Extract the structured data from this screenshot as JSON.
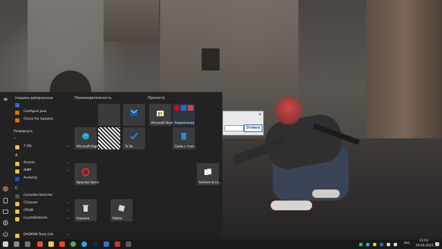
{
  "start_menu": {
    "recent_header": "Недавно добавленные",
    "recent_items": [
      {
        "label": "",
        "icon": "app-icon",
        "color": "#2b6cd8"
      },
      {
        "label": "Configure Java",
        "icon": "java-icon",
        "color": "#e76f00"
      },
      {
        "label": "Check For Updates",
        "icon": "java-icon",
        "color": "#e76f00"
      }
    ],
    "expand_label": "Развернуть",
    "apps": [
      {
        "label": "7-Zip",
        "icon": "folder-icon",
        "color": "#f3c24a",
        "chevron": true
      },
      {
        "label": "",
        "icon": "letter-a",
        "color": ""
      },
      {
        "label": "Acronis",
        "icon": "folder-icon",
        "color": "#f3c24a",
        "chevron": true
      },
      {
        "label": "AIMP",
        "icon": "folder-icon",
        "color": "#f3c24a",
        "chevron": true
      },
      {
        "label": "Audacity",
        "icon": "audacity-icon",
        "color": "#2a4fd6",
        "chevron": false
      },
      {
        "label": "",
        "icon": "letter-c",
        "color": ""
      },
      {
        "label": "Caramba Switcher",
        "icon": "caramba-icon",
        "color": "#555555",
        "chevron": false
      },
      {
        "label": "CCleaner",
        "icon": "folder-icon",
        "color": "#f3c24a",
        "chevron": true
      },
      {
        "label": "CPUID",
        "icon": "folder-icon",
        "color": "#f3c24a",
        "chevron": true
      },
      {
        "label": "CrystalDiskInfo",
        "icon": "folder-icon",
        "color": "#f3c24a",
        "chevron": true
      },
      {
        "label": "DAEMON Tools Lite",
        "icon": "folder-icon",
        "color": "#f3c24a",
        "chevron": true
      }
    ],
    "letters": {
      "a": "A",
      "c": "C"
    },
    "groups": {
      "productivity": "Производительность",
      "explore": "Просмотр"
    },
    "tiles": {
      "edge": "Microsoft Edge",
      "todo": "To Do",
      "store": "Microsoft Store",
      "entertainment": "Развлечения",
      "phone": "Связь с теле...",
      "opera": "Браузер Opera",
      "solitaire": "Solitaire & Ca...",
      "recycle": "Корзина",
      "roblox": "Roblox"
    }
  },
  "dialog": {
    "close_glyph": "×",
    "cancel_label": "Отмена"
  },
  "taskbar": {
    "icons": [
      "start-icon",
      "search-icon",
      "taskview-icon",
      "explorer-icon",
      "opera-icon",
      "yandex-icon",
      "chrome-icon",
      "telegram-icon",
      "steam-icon",
      "vlc-icon",
      "ccleaner-icon",
      "photos-icon"
    ],
    "lang": "РУС",
    "time": "11:03",
    "date": "26.04.2021"
  },
  "colors": {
    "accent": "#0a64c8",
    "menu_bg": "#212121",
    "tile_bg": "#3b3b3b"
  }
}
